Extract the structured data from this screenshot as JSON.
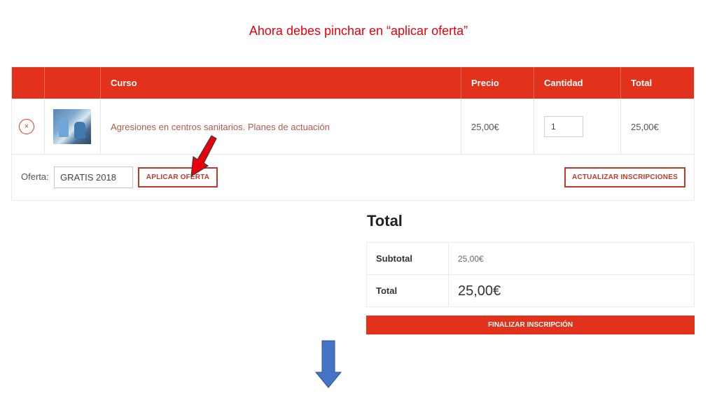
{
  "instruction": "Ahora debes pinchar en “aplicar oferta”",
  "cart": {
    "headers": {
      "course": "Curso",
      "price": "Precio",
      "quantity": "Cantidad",
      "total": "Total"
    },
    "rows": [
      {
        "remove_icon": "×",
        "course": "Agresiones en centros sanitarios. Planes de actuación",
        "price": "25,00€",
        "quantity": "1",
        "total": "25,00€"
      }
    ],
    "coupon": {
      "label": "Oferta:",
      "value": "GRATIS 2018",
      "apply_label": "APLICAR OFERTA"
    },
    "update_label": "ACTUALIZAR INSCRIPCIONES"
  },
  "totals": {
    "title": "Total",
    "subtotal_label": "Subtotal",
    "subtotal_value": "25,00€",
    "total_label": "Total",
    "total_value": "25,00€"
  },
  "checkout_label": "FINALIZAR INSCRIPCIÓN",
  "colors": {
    "accent": "#e3321b",
    "instruction_text": "#e8000b",
    "pointer_arrow": "#e8000b",
    "down_arrow": "#4472c4"
  },
  "icons": [
    "remove-icon",
    "pointer-arrow-icon",
    "down-arrow-icon"
  ]
}
